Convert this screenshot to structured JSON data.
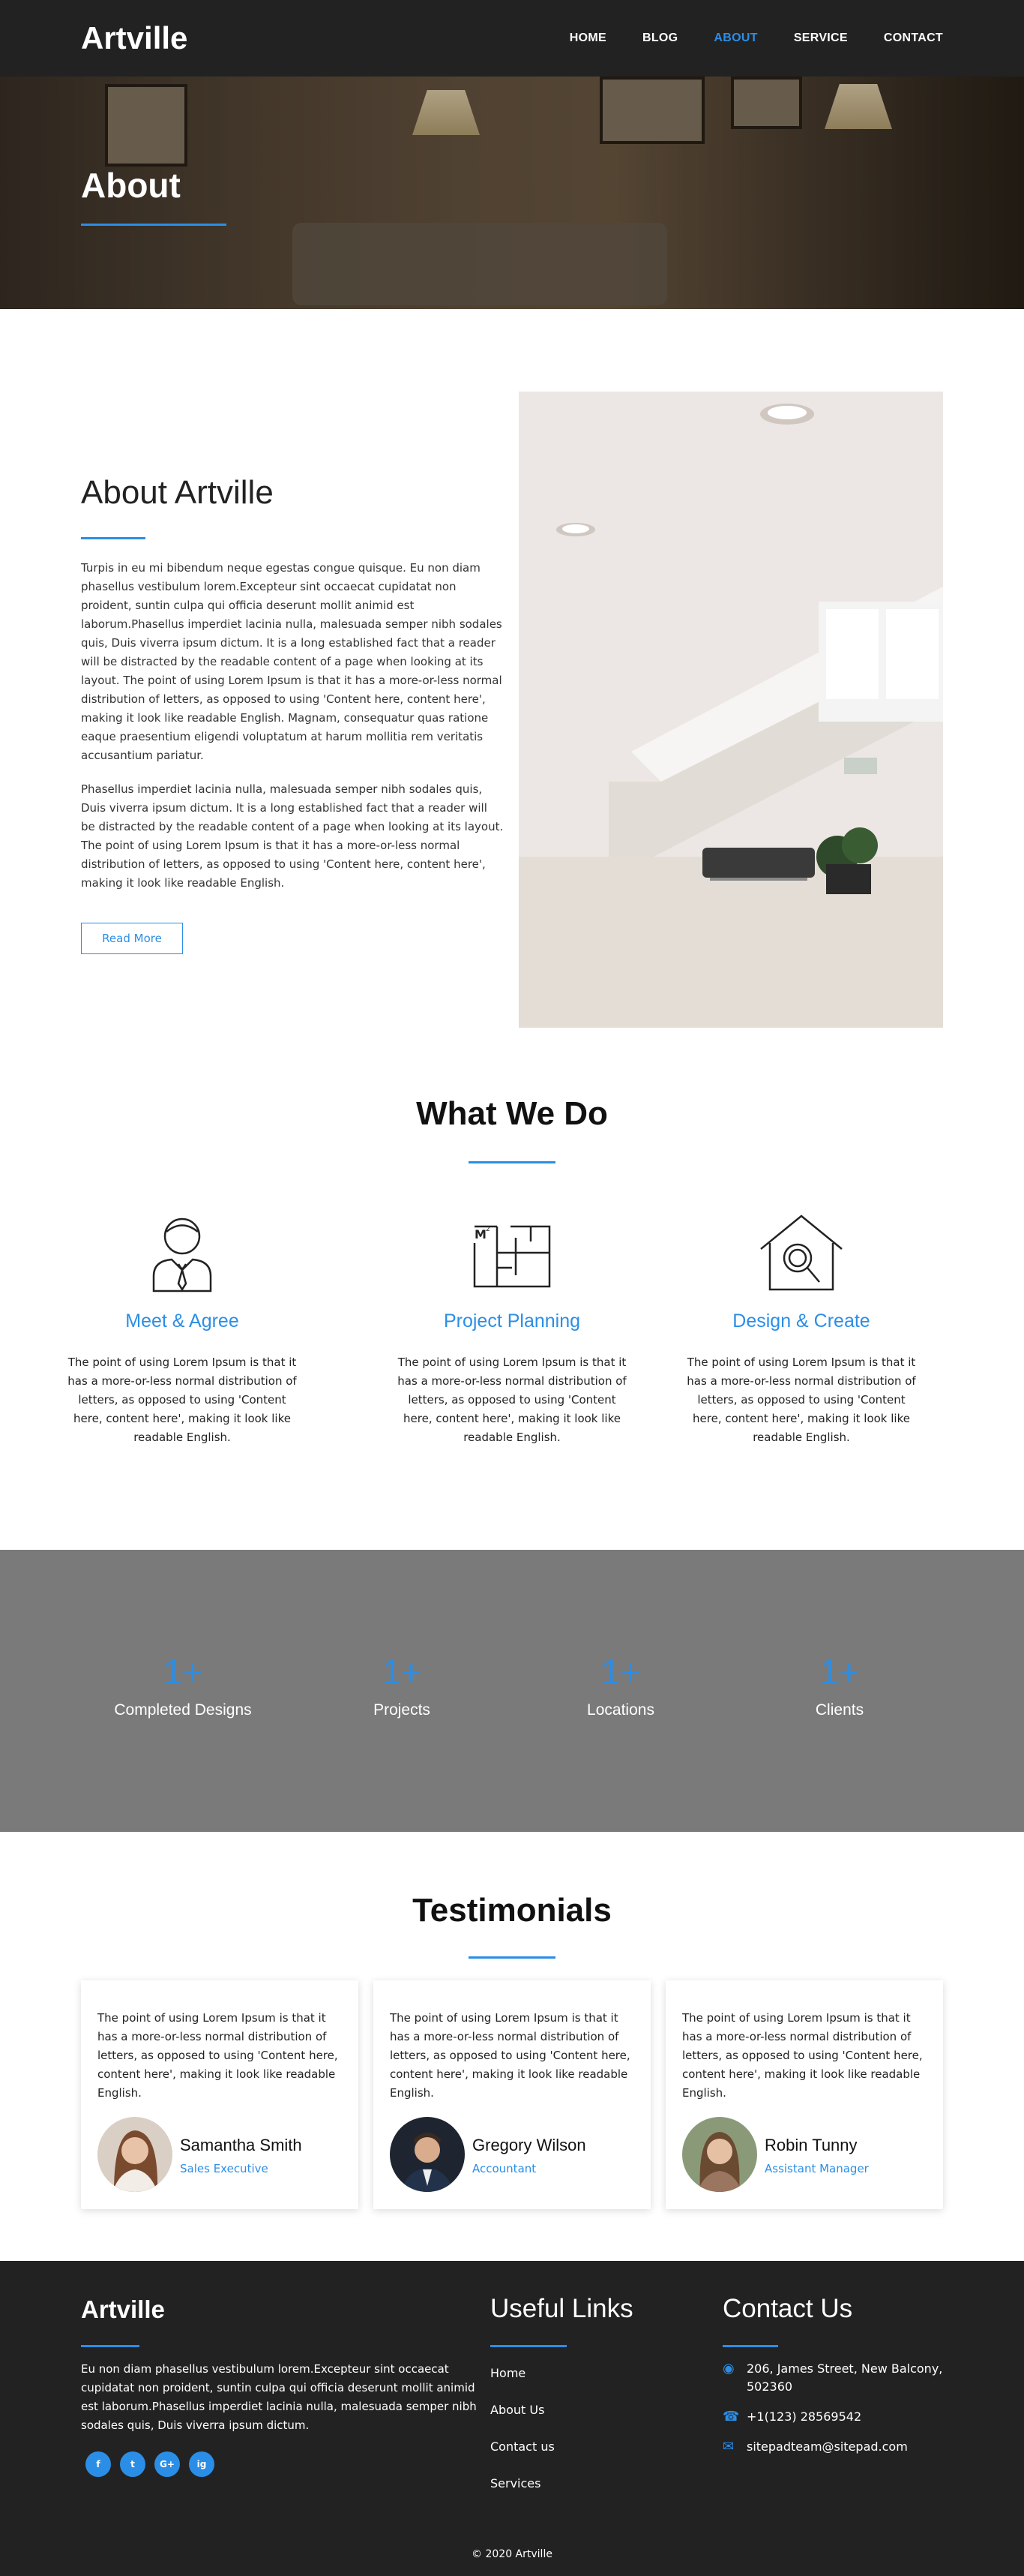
{
  "brand": "Artville",
  "nav": {
    "home": "HOME",
    "blog": "BLOG",
    "about": "ABOUT",
    "service": "SERVICE",
    "contact": "CONTACT"
  },
  "hero": {
    "title": "About"
  },
  "about": {
    "heading": "About Artville",
    "p1": "Turpis in eu mi bibendum neque egestas congue quisque. Eu non diam phasellus vestibulum lorem.Excepteur sint occaecat cupidatat non proident, suntin culpa qui officia deserunt mollit animid est laborum.Phasellus imperdiet lacinia nulla, malesuada semper nibh sodales quis, Duis viverra ipsum dictum. It is a long established fact that a reader will be distracted by the readable content of a page when looking at its layout. The point of using Lorem Ipsum is that it has a more-or-less normal distribution of letters, as opposed to using 'Content here, content here', making it look like readable English. Magnam, consequatur quas ratione eaque praesentium eligendi voluptatum at harum mollitia rem veritatis accusantium pariatur.",
    "p2": "Phasellus imperdiet lacinia nulla, malesuada semper nibh sodales quis, Duis viverra ipsum dictum. It is a long established fact that a reader will be distracted by the readable content of a page when looking at its layout. The point of using Lorem Ipsum is that it has a more-or-less normal distribution of letters, as opposed to using 'Content here, content here', making it look like readable English.",
    "button": "Read More"
  },
  "services": {
    "heading": "What We Do",
    "items": [
      {
        "title": "Meet & Agree",
        "icon": "person-tie-icon",
        "text": "The point of using Lorem Ipsum is that it has a more-or-less normal distribution of letters, as opposed to using 'Content here, content here', making it look like readable English."
      },
      {
        "title": "Project Planning",
        "icon": "floor-plan-icon",
        "sup": "M",
        "text": "The point of using Lorem Ipsum is that it has a more-or-less normal distribution of letters, as opposed to using 'Content here, content here', making it look like readable English."
      },
      {
        "title": "Design & Create",
        "icon": "house-search-icon",
        "text": "The point of using Lorem Ipsum is that it has a more-or-less normal distribution of letters, as opposed to using 'Content here, content here', making it look like readable English."
      }
    ]
  },
  "stats": [
    {
      "num": "1+",
      "label": "Completed Designs"
    },
    {
      "num": "1+",
      "label": "Projects"
    },
    {
      "num": "1+",
      "label": "Locations"
    },
    {
      "num": "1+",
      "label": "Clients"
    }
  ],
  "testimonials": {
    "heading": "Testimonials",
    "items": [
      {
        "text": "The point of using Lorem Ipsum is that it has a more-or-less normal distribution of letters, as opposed to using 'Content here, content here', making it look like readable English.",
        "name": "Samantha Smith",
        "role": "Sales Executive"
      },
      {
        "text": "The point of using Lorem Ipsum is that it has a more-or-less normal distribution of letters, as opposed to using 'Content here, content here', making it look like readable English.",
        "name": "Gregory Wilson",
        "role": "Accountant"
      },
      {
        "text": "The point of using Lorem Ipsum is that it has a more-or-less normal distribution of letters, as opposed to using 'Content here, content here', making it look like readable English.",
        "name": "Robin Tunny",
        "role": "Assistant Manager"
      }
    ]
  },
  "footer": {
    "brand": "Artville",
    "about": "Eu non diam phasellus vestibulum lorem.Excepteur sint occaecat cupidatat non proident, suntin culpa qui officia deserunt mollit animid est laborum.Phasellus imperdiet lacinia nulla, malesuada semper nibh sodales quis, Duis viverra ipsum dictum.",
    "social": [
      "f",
      "t",
      "G+",
      "ig"
    ],
    "links_heading": "Useful Links",
    "links": [
      "Home",
      "About Us",
      "Contact us",
      "Services"
    ],
    "contact_heading": "Contact Us",
    "address": "206, James Street, New Balcony, 502360",
    "phone": "+1(123) 28569542",
    "email": "sitepadteam@sitepad.com",
    "copyright": "© 2020 Artville"
  },
  "colors": {
    "accent": "#2b8ee6",
    "dark": "#222222",
    "stats_bg": "#7a7a7a"
  }
}
